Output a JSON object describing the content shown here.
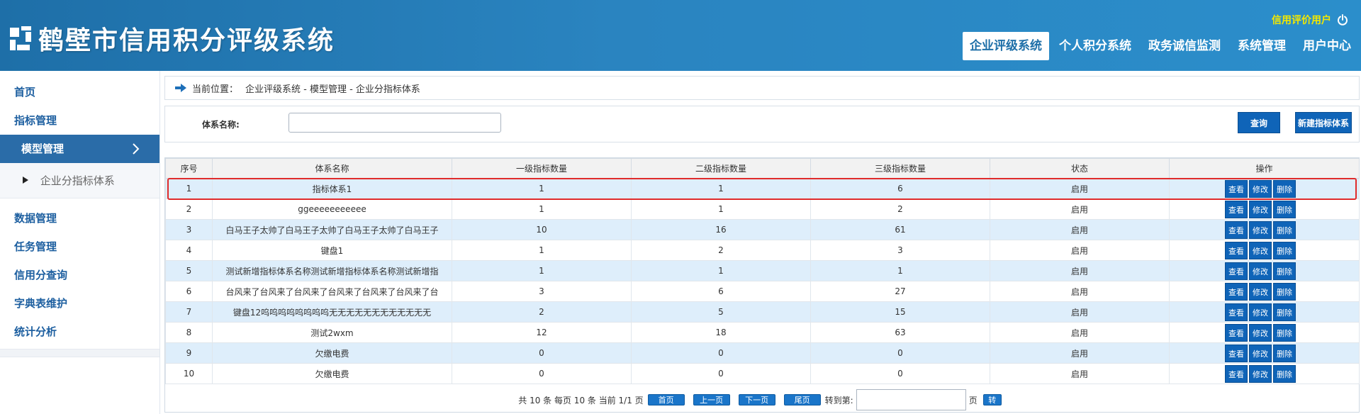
{
  "header": {
    "title": "鹤壁市信用积分评级系统",
    "user": "信用评价用户",
    "nav": [
      {
        "label": "企业评级系统",
        "active": true
      },
      {
        "label": "个人积分系统",
        "active": false
      },
      {
        "label": "政务诚信监测",
        "active": false
      },
      {
        "label": "系统管理",
        "active": false
      },
      {
        "label": "用户中心",
        "active": false
      }
    ]
  },
  "sidebar": {
    "items": [
      {
        "label": "首页"
      },
      {
        "label": "指标管理"
      },
      {
        "label": "模型管理"
      },
      {
        "label": "企业分指标体系"
      },
      {
        "label": "数据管理"
      },
      {
        "label": "任务管理"
      },
      {
        "label": "信用分查询"
      },
      {
        "label": "字典表维护"
      },
      {
        "label": "统计分析"
      }
    ]
  },
  "breadcrumb": {
    "label": "当前位置：",
    "path": "企业评级系统 - 模型管理 - 企业分指标体系"
  },
  "search": {
    "label": "体系名称:",
    "value": "",
    "query_button": "查询",
    "new_button": "新建指标体系"
  },
  "table": {
    "headers": [
      "序号",
      "体系名称",
      "一级指标数量",
      "二级指标数量",
      "三级指标数量",
      "状态",
      "操作"
    ],
    "actions": {
      "view": "查看",
      "edit": "修改",
      "delete": "删除"
    },
    "rows": [
      {
        "no": "1",
        "name": "指标体系1",
        "l1": "1",
        "l2": "1",
        "l3": "6",
        "status": "启用"
      },
      {
        "no": "2",
        "name": "ggeeeeeeeeeee",
        "l1": "1",
        "l2": "1",
        "l3": "2",
        "status": "启用"
      },
      {
        "no": "3",
        "name": "白马王子太帅了白马王子太帅了白马王子太帅了白马王子",
        "l1": "10",
        "l2": "16",
        "l3": "61",
        "status": "启用"
      },
      {
        "no": "4",
        "name": "键盘1",
        "l1": "1",
        "l2": "2",
        "l3": "3",
        "status": "启用"
      },
      {
        "no": "5",
        "name": "测试新增指标体系名称测试新增指标体系名称测试新增指",
        "l1": "1",
        "l2": "1",
        "l3": "1",
        "status": "启用"
      },
      {
        "no": "6",
        "name": "台风来了台风来了台风来了台风来了台风来了台风来了台",
        "l1": "3",
        "l2": "6",
        "l3": "27",
        "status": "启用"
      },
      {
        "no": "7",
        "name": "键盘12呜呜呜呜呜呜呜呜无无无无无无无无无无无无",
        "l1": "2",
        "l2": "5",
        "l3": "15",
        "status": "启用"
      },
      {
        "no": "8",
        "name": "测试2wxm",
        "l1": "12",
        "l2": "18",
        "l3": "63",
        "status": "启用"
      },
      {
        "no": "9",
        "name": "欠缴电费",
        "l1": "0",
        "l2": "0",
        "l3": "0",
        "status": "启用"
      },
      {
        "no": "10",
        "name": "欠缴电费",
        "l1": "0",
        "l2": "0",
        "l3": "0",
        "status": "启用"
      }
    ]
  },
  "pager": {
    "summary": "共 10 条 每页 10 条 当前 1/1 页",
    "first": "首页",
    "prev": "上一页",
    "next": "下一页",
    "last": "尾页",
    "goto_label": "转到第:",
    "page_unit": "页",
    "go": "转"
  },
  "colors": {
    "header_blue": "#2a84c0",
    "accent_blue": "#0f64b8",
    "user_yellow": "#f3e800",
    "row_highlight": "#deeefb",
    "selection_red": "#e02b2b"
  }
}
